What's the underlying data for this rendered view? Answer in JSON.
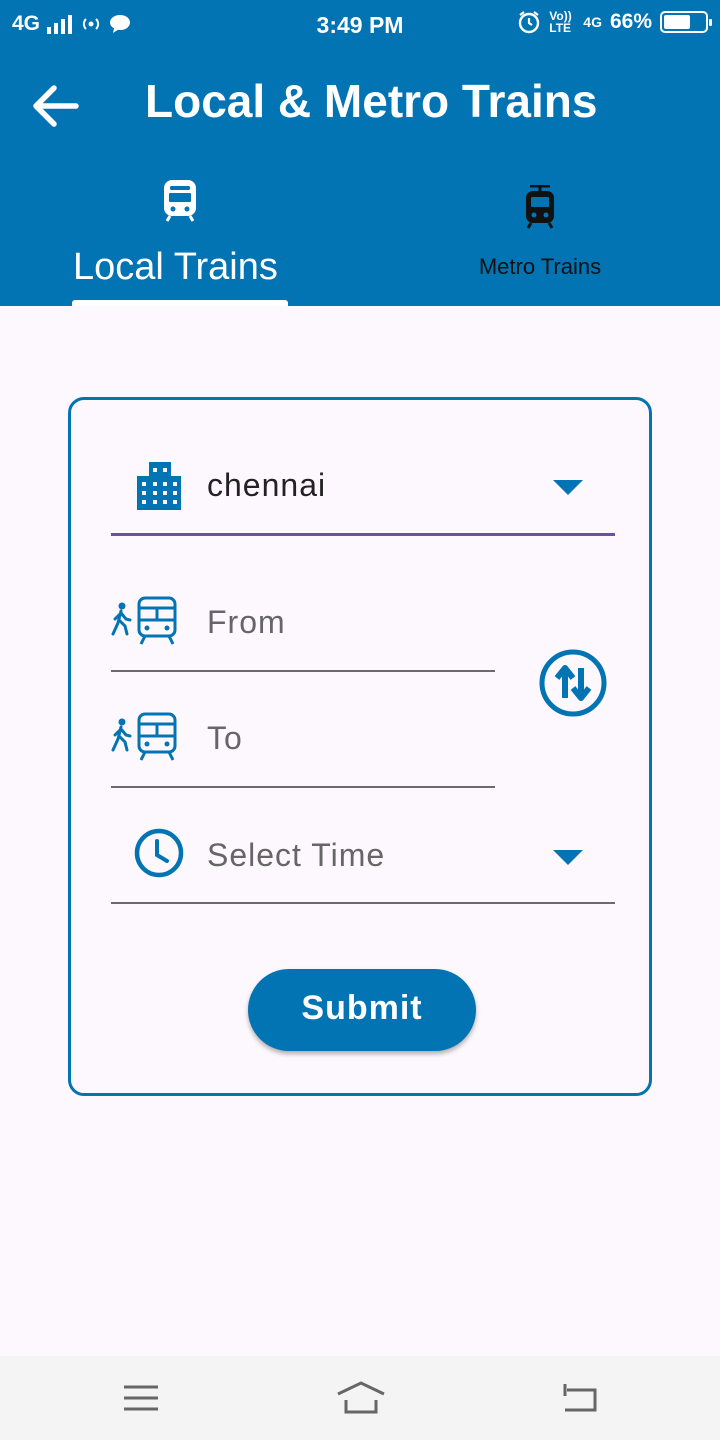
{
  "status_bar": {
    "network": "4G",
    "time": "3:49 PM",
    "volte": "Vo)) LTE",
    "network_right": "4G",
    "battery_percent": "66%",
    "battery_level": 0.66
  },
  "header": {
    "title": "Local & Metro Trains",
    "back_icon": "arrow-left-icon"
  },
  "tabs": [
    {
      "label": "Local Trains",
      "icon": "train-icon",
      "selected": true
    },
    {
      "label": "Metro Trains",
      "icon": "tram-icon",
      "selected": false
    }
  ],
  "form": {
    "city": {
      "value": "chennai",
      "icon": "city-icon"
    },
    "from": {
      "placeholder": "From",
      "icon": "train-walk-icon"
    },
    "to": {
      "placeholder": "To",
      "icon": "train-walk-icon"
    },
    "time": {
      "placeholder": "Select Time",
      "icon": "clock-icon"
    },
    "swap_icon": "swap-vert-icon",
    "submit_label": "Submit"
  },
  "colors": {
    "primary": "#0273b3",
    "underline_active": "#6a4fa3",
    "background": "#fdf8fd"
  }
}
